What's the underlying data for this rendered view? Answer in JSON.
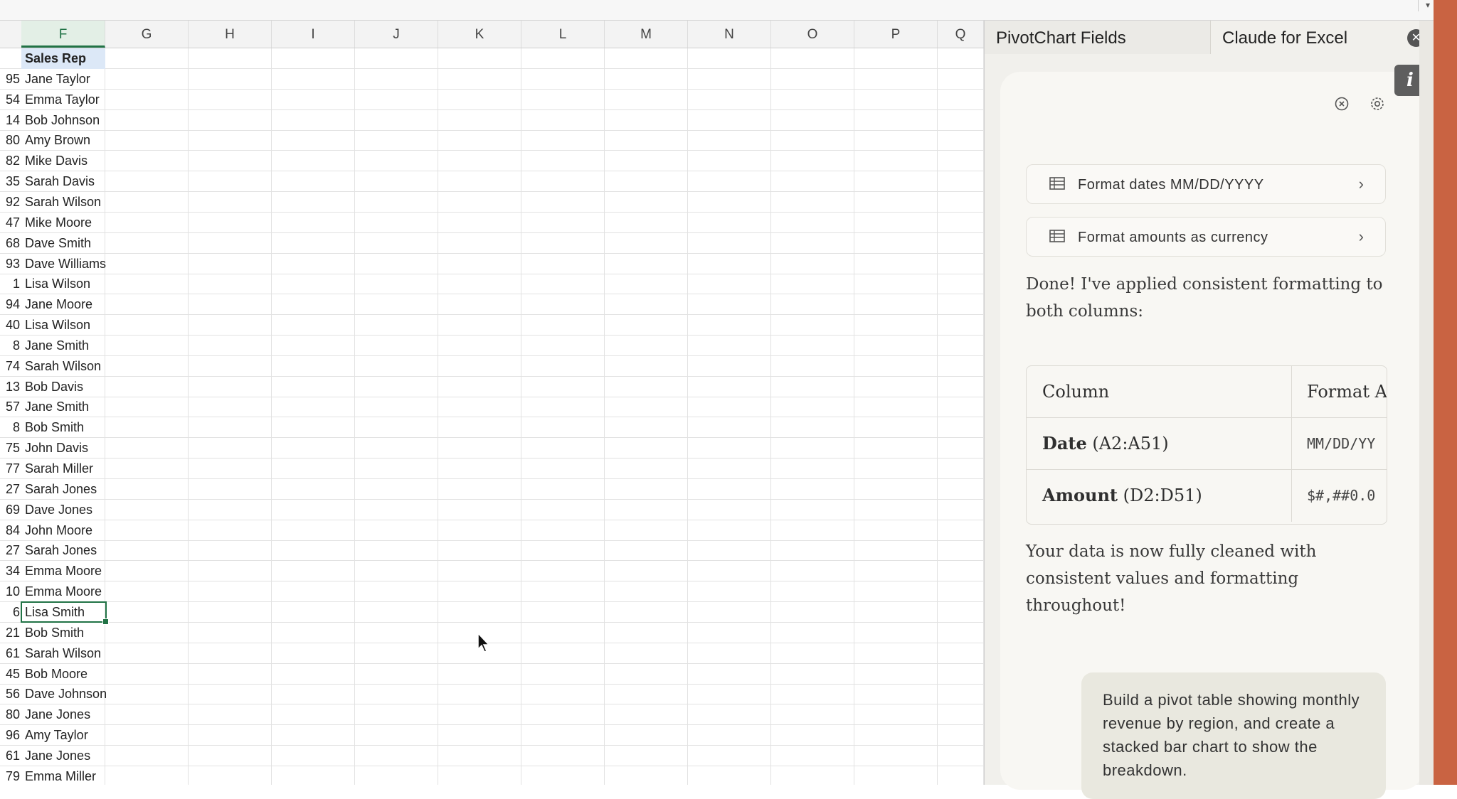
{
  "sheet": {
    "columns": [
      "F",
      "G",
      "H",
      "I",
      "J",
      "K",
      "L",
      "M",
      "N",
      "O",
      "P",
      "Q"
    ],
    "active_column": "F",
    "header_cell": "Sales Rep",
    "rows": [
      {
        "num": "95",
        "name": "Jane Taylor"
      },
      {
        "num": "54",
        "name": "Emma Taylor"
      },
      {
        "num": "14",
        "name": "Bob Johnson"
      },
      {
        "num": "80",
        "name": "Amy Brown"
      },
      {
        "num": "82",
        "name": "Mike Davis"
      },
      {
        "num": "35",
        "name": "Sarah Davis"
      },
      {
        "num": "92",
        "name": "Sarah Wilson"
      },
      {
        "num": "47",
        "name": "Mike Moore"
      },
      {
        "num": "68",
        "name": "Dave Smith"
      },
      {
        "num": "93",
        "name": "Dave Williams"
      },
      {
        "num": "1",
        "name": "Lisa Wilson"
      },
      {
        "num": "94",
        "name": "Jane Moore"
      },
      {
        "num": "40",
        "name": "Lisa Wilson"
      },
      {
        "num": "8",
        "name": "Jane Smith"
      },
      {
        "num": "74",
        "name": "Sarah Wilson"
      },
      {
        "num": "13",
        "name": "Bob Davis"
      },
      {
        "num": "57",
        "name": "Jane Smith"
      },
      {
        "num": "8",
        "name": "Bob Smith"
      },
      {
        "num": "75",
        "name": "John Davis"
      },
      {
        "num": "77",
        "name": "Sarah Miller"
      },
      {
        "num": "27",
        "name": "Sarah Jones"
      },
      {
        "num": "69",
        "name": "Dave Jones"
      },
      {
        "num": "84",
        "name": "John Moore"
      },
      {
        "num": "27",
        "name": "Sarah Jones"
      },
      {
        "num": "34",
        "name": "Emma Moore"
      },
      {
        "num": "10",
        "name": "Emma Moore"
      },
      {
        "num": "6",
        "name": "Lisa Smith"
      },
      {
        "num": "21",
        "name": "Bob Smith"
      },
      {
        "num": "61",
        "name": "Sarah Wilson"
      },
      {
        "num": "45",
        "name": "Bob Moore"
      },
      {
        "num": "56",
        "name": "Dave Johnson"
      },
      {
        "num": "80",
        "name": "Jane Jones"
      },
      {
        "num": "96",
        "name": "Amy Taylor"
      },
      {
        "num": "61",
        "name": "Jane Jones"
      },
      {
        "num": "79",
        "name": "Emma Miller"
      }
    ],
    "selected_cell_value": "Lisa Smith"
  },
  "pane": {
    "tabs": [
      "PivotChart Fields",
      "Claude for Excel"
    ],
    "active_tab": "Claude for Excel",
    "suggestions": [
      "Format dates MM/DD/YYYY",
      "Format amounts as currency"
    ],
    "message1": "Done! I've applied consistent formatting to both columns:",
    "table": {
      "headers": [
        "Column",
        "Format A"
      ],
      "rows": [
        {
          "name": "Date",
          "range": "(A2:A51)",
          "format": "MM/DD/YY"
        },
        {
          "name": "Amount",
          "range": "(D2:D51)",
          "format": "$#,##0.0"
        }
      ]
    },
    "message2": "Your data is now fully cleaned with consistent values and formatting throughout!",
    "user_message": "Build a pivot table showing monthly revenue by region, and create a stacked bar chart to show the breakdown.",
    "accent_color": "#c96342",
    "icons": [
      "close-icon",
      "info-icon",
      "history-icon",
      "settings-icon",
      "table-icon",
      "chevron-right-icon"
    ]
  }
}
